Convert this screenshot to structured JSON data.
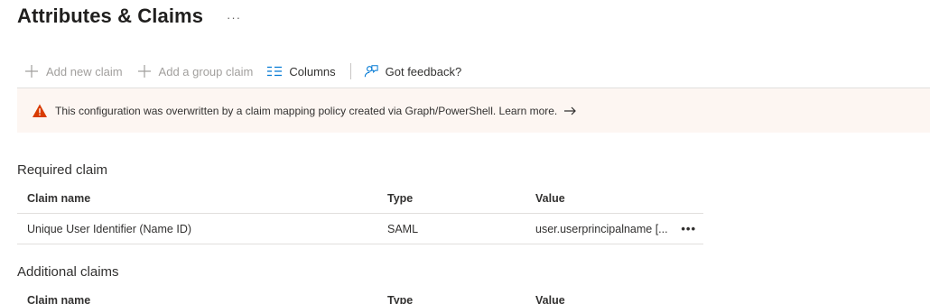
{
  "header": {
    "title": "Attributes & Claims",
    "more": "···"
  },
  "toolbar": {
    "add_new_claim": "Add new claim",
    "add_group_claim": "Add a group claim",
    "columns": "Columns",
    "feedback": "Got feedback?"
  },
  "banner": {
    "message": "This configuration was overwritten by a claim mapping policy created via Graph/PowerShell. Learn more.",
    "arrow_icon": "arrow-right-icon"
  },
  "required": {
    "title": "Required claim",
    "columns": [
      "Claim name",
      "Type",
      "Value"
    ],
    "rows": [
      {
        "name": "Unique User Identifier (Name ID)",
        "type": "SAML",
        "value": "user.userprincipalname [...",
        "more": "•••"
      }
    ]
  },
  "additional": {
    "title": "Additional claims",
    "columns": [
      "Claim name",
      "Type",
      "Value"
    ]
  },
  "colors": {
    "accent": "#0078d4",
    "warning": "#d83b01",
    "banner_bg": "#fdf6f2"
  }
}
